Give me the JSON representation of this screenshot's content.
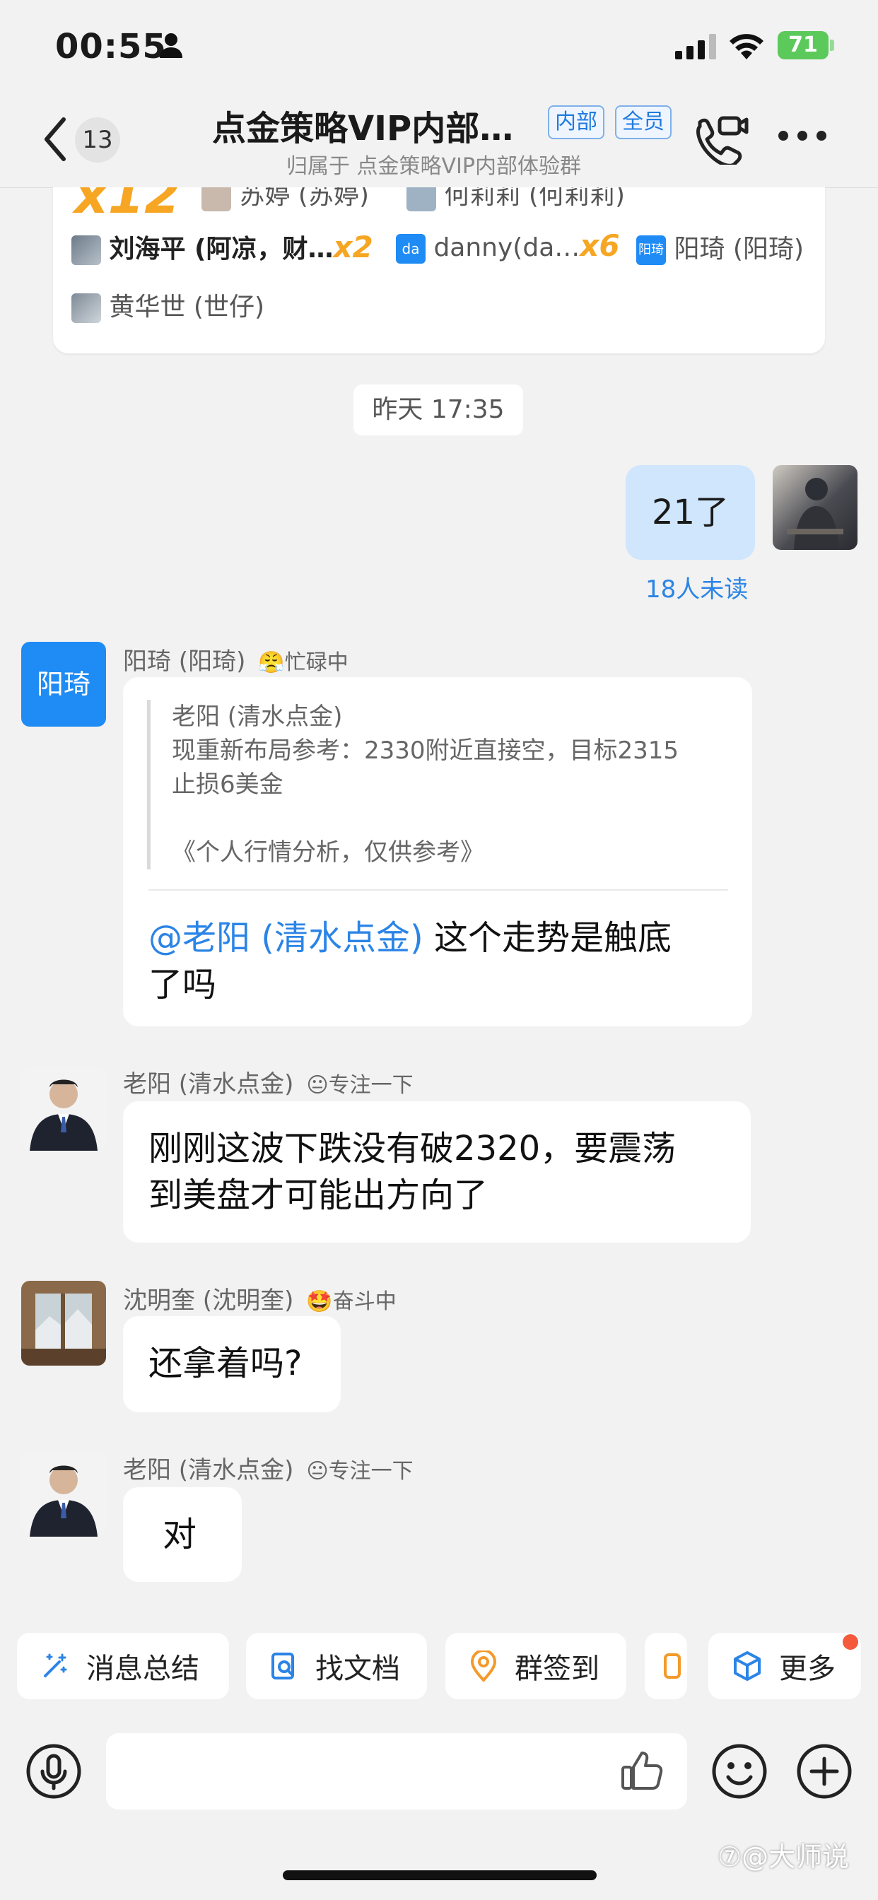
{
  "status_bar": {
    "time": "00:55",
    "battery": "71"
  },
  "header": {
    "unread_count": "13",
    "title": "点金策略VIP内部…",
    "tags": [
      "内部",
      "全员"
    ],
    "subtitle": "归属于 点金策略VIP内部体验群"
  },
  "reaction_card": {
    "top_row": [
      {
        "count": "x12"
      },
      {
        "name": "苏婷 (苏婷)"
      },
      {
        "name": "何莉莉 (何莉莉)"
      }
    ],
    "row2": [
      {
        "name": "刘海平 (阿凉，财…",
        "count": "x2"
      },
      {
        "avatar_text": "da",
        "name": "danny(da…",
        "count": "x6"
      },
      {
        "avatar_text": "阳琦",
        "name": "阳琦 (阳琦)"
      }
    ],
    "row3": [
      {
        "name": "黄华世 (世仔)"
      }
    ]
  },
  "time_divider": "昨天 17:35",
  "self_message": {
    "text": "21了",
    "read_status": "18人未读"
  },
  "messages": [
    {
      "sender": "阳琦 (阳琦)",
      "avatar_text": "阳琦",
      "status": "忙碌中",
      "quote": {
        "author": "老阳 (清水点金)",
        "line1": "现重新布局参考：2330附近直接空，目标2315",
        "line2": "止损6美金",
        "line3": "《个人行情分析，仅供参考》"
      },
      "mention": "@老阳 (清水点金)",
      "text_after_mention": " 这个走势是触底",
      "text_line2": "了吗"
    },
    {
      "sender": "老阳 (清水点金)",
      "status": "专注一下",
      "text_line1": "刚刚这波下跌没有破2320，要震荡",
      "text_line2": "到美盘才可能出方向了"
    },
    {
      "sender": "沈明奎 (沈明奎)",
      "status": "奋斗中",
      "text": "还拿着吗?"
    },
    {
      "sender": "老阳 (清水点金)",
      "status": "专注一下",
      "text": "对"
    }
  ],
  "toolbar": {
    "summary": "消息总结",
    "find_docs": "找文档",
    "check_in": "群签到",
    "more": "更多"
  },
  "watermark": "⑦@大师说",
  "colors": {
    "accent": "#2b84e6",
    "bubble_self": "#cfe6fd",
    "reaction": "#f6a623",
    "battery": "#5cc95b"
  }
}
